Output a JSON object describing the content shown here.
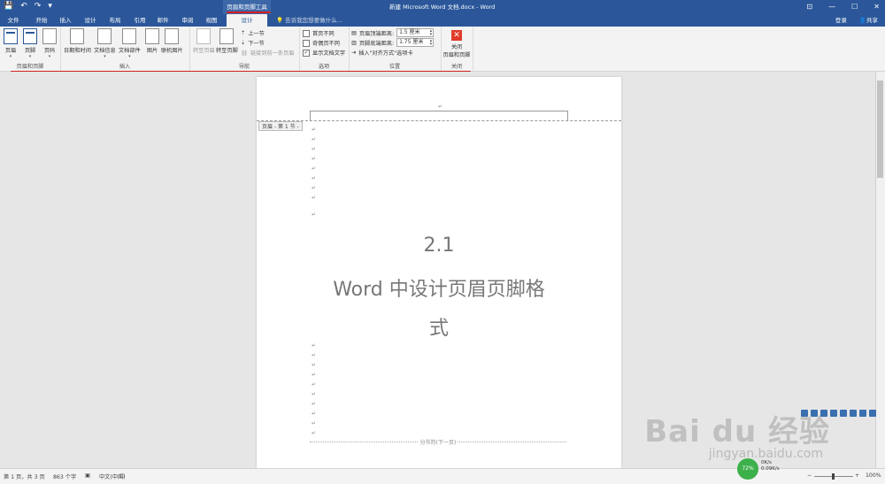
{
  "titlebar": {
    "qat": [
      "save-icon",
      "undo-icon",
      "redo-icon",
      "customize-icon"
    ],
    "context_tool": "页眉和页脚工具",
    "document_title": "新建 Microsoft Word 文档.docx - Word",
    "window_controls": [
      "restore-icon",
      "minimize-icon",
      "maximize-icon",
      "close-icon"
    ]
  },
  "tabs": {
    "items": [
      "文件",
      "开始",
      "插入",
      "设计",
      "布局",
      "引用",
      "邮件",
      "审阅",
      "视图",
      "设计"
    ],
    "active": "设计",
    "tell_me": "告诉我您想要做什么...",
    "login": "登录",
    "share": "共享"
  },
  "ribbon": {
    "header_footer": {
      "label": "页眉和页脚",
      "buttons": [
        "页眉",
        "页脚",
        "页码"
      ]
    },
    "insert": {
      "label": "插入",
      "buttons": [
        "日期和时间",
        "文档信息",
        "文档部件",
        "图片",
        "联机图片"
      ]
    },
    "navigation": {
      "label": "导航",
      "goto_header": "转至页眉",
      "goto_footer": "转至页脚",
      "prev": "上一节",
      "next": "下一节",
      "link_prev": "链接到前一条页眉"
    },
    "options": {
      "label": "选项",
      "first_page": "首页不同",
      "odd_even": "奇偶页不同",
      "show_text": "显示文档文字",
      "show_text_checked": true
    },
    "position": {
      "label": "位置",
      "header_top": "页眉顶端距离:",
      "header_top_value": "1.5 厘米",
      "footer_bottom": "页脚底端距离:",
      "footer_bottom_value": "1.75 厘米",
      "insert_tab": "插入\"对齐方式\"选项卡"
    },
    "close": {
      "label": "关闭",
      "button_line1": "关闭",
      "button_line2": "页眉和页脚"
    }
  },
  "page": {
    "header_tag": "页眉 - 第 1 节 -",
    "para_mark": "↵",
    "title_line1": "2.1",
    "title_line2": "Word 中设计页眉页脚格",
    "title_line3": "式",
    "section_break": "分节符(下一页)"
  },
  "statusbar": {
    "page_info": "第 1 页，共 3 页",
    "word_count": "863 个字",
    "language": "中文(中国)",
    "zoom": "100%"
  },
  "tray": {
    "net_percent": "72%",
    "up": "0K/s",
    "down": "0.09K/s"
  },
  "watermark": {
    "brand": "Bai du 经验",
    "url": "jingyan.baidu.com"
  },
  "colors": {
    "accent": "#2b579a",
    "annotation": "#d21f1f"
  }
}
